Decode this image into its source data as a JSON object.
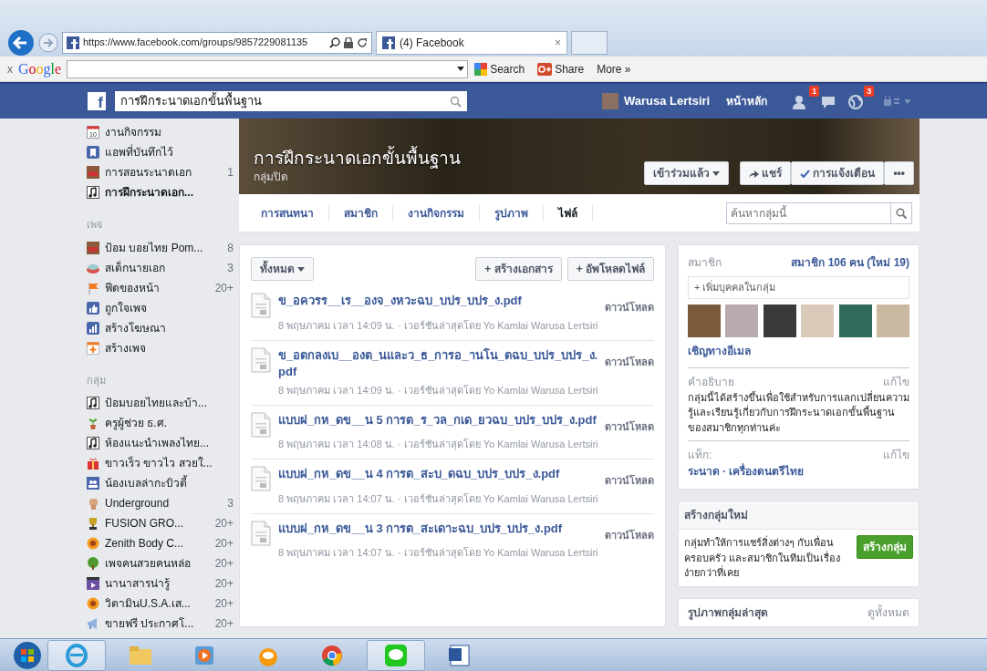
{
  "browser": {
    "address": "https://www.facebook.com/groups/9857229081135",
    "tabs": [
      {
        "title": "(4) Facebook",
        "close": "×",
        "selected": true
      }
    ],
    "toolbar": {
      "close": "x",
      "logo": "Google",
      "search": "Search",
      "share": "Share",
      "more": "More »"
    }
  },
  "fb_header": {
    "logo": "f",
    "search_value": "การฝึกระนาดเอกขั้นพื้นฐาน",
    "user": "Warusa Lertsiri",
    "home": "หน้าหลัก",
    "notifications": [
      {
        "kind": "friends",
        "count": "1"
      },
      {
        "kind": "messages"
      },
      {
        "kind": "globe",
        "count": "3"
      }
    ]
  },
  "sidebar": [
    {
      "items": [
        {
          "kind": "calendar",
          "icon_text": "10",
          "label": "งานกิจกรรม",
          "selected": false
        },
        {
          "kind": "bookmark",
          "label": "แอพที่บันทึกไว้",
          "selected": false
        },
        {
          "kind": "photo",
          "label": "การสอนระนาดเอก",
          "count": "1",
          "selected": false
        },
        {
          "kind": "music",
          "label": "การฝึกระนาดเอก...",
          "selected": true
        }
      ]
    },
    {
      "heading": "เพจ",
      "items": [
        {
          "kind": "photo",
          "label": "ป้อม บอยไทย Pom...",
          "count": "8",
          "selected": false
        },
        {
          "kind": "bowl",
          "label": "สเต็กนายเอก",
          "count": "3",
          "selected": false
        },
        {
          "kind": "flag",
          "label": "ฟีดของหน้า",
          "count": "20+",
          "selected": false
        },
        {
          "kind": "like",
          "label": "ถูกใจเพจ",
          "selected": false
        },
        {
          "kind": "chart",
          "label": "สร้างโฆษณา",
          "selected": false
        },
        {
          "kind": "plus",
          "label": "สร้างเพจ",
          "selected": false
        }
      ]
    },
    {
      "heading": "กลุ่ม",
      "items": [
        {
          "kind": "music",
          "label": "ป้อมบอยไทยและบ้า...",
          "selected": false
        },
        {
          "kind": "plant",
          "label": "ครูผู้ช่วย ธ.ศ.",
          "selected": false
        },
        {
          "kind": "music",
          "label": "ห้องแนะนำเพลงไทย...",
          "selected": false
        },
        {
          "kind": "gift",
          "label": "ขาวเร็ว ขาวไว สวยใ...",
          "selected": false
        },
        {
          "kind": "people",
          "label": "น้องเบลล่ากะบิวตี้",
          "selected": false
        },
        {
          "kind": "fist",
          "label": "Underground",
          "count": "3",
          "selected": false
        },
        {
          "kind": "trophy",
          "label": "FUSION GRO...",
          "count": "20+",
          "selected": false
        },
        {
          "kind": "flower",
          "label": "Zenith Body C...",
          "count": "20+",
          "selected": false
        },
        {
          "kind": "tree",
          "label": "เพจคนสวยคนหล่อ",
          "count": "20+",
          "selected": false
        },
        {
          "kind": "film",
          "label": "นานาสารน่ารู้",
          "count": "20+",
          "selected": false
        },
        {
          "kind": "flower",
          "label": "วิตามินU.S.A.เส...",
          "count": "20+",
          "selected": false
        },
        {
          "kind": "megaphone",
          "label": "ขายฟรี ประกาศโ...",
          "count": "20+",
          "selected": false
        }
      ]
    }
  ],
  "group": {
    "title": "การฝึกระนาดเอกขั้นพื้นฐาน",
    "privacy": "กลุ่มปิด",
    "joined": "เข้าร่วมแล้ว",
    "share": "แชร์",
    "notifications": "การแจ้งเตือน",
    "more": "•••",
    "tabs": [
      {
        "label": "การสนทนา",
        "selected": false
      },
      {
        "label": "สมาชิก",
        "selected": false
      },
      {
        "label": "งานกิจกรรม",
        "selected": false
      },
      {
        "label": "รูปภาพ",
        "selected": false
      },
      {
        "label": "ไฟล์",
        "selected": true
      }
    ],
    "search_placeholder": "ค้นหากลุ่มนี้"
  },
  "files": {
    "filter": "ทั้งหมด",
    "create": "+ สร้างเอกสาร",
    "upload": "+ อัพโหลดไฟล์",
    "items": [
      {
        "name": "ข_อควรร__เร__องจ_งหวะฉบ_บปร_บปร_ง.pdf",
        "meta": "8 พฤษภาคม เวลา 14:09 น. · เวอร์ชันล่าสุดโดย Yo Kamlai Warusa Lertsiri",
        "action": "ดาวน์โหลด"
      },
      {
        "name": "ข_อตกลงเบ__องต_นและว_ธ_การอ_านโน_ตฉบ_บปร_บปร_ง.pdf",
        "meta": "8 พฤษภาคม เวลา 14:09 น. · เวอร์ชันล่าสุดโดย Yo Kamlai Warusa Lertsiri",
        "action": "ดาวน์โหลด"
      },
      {
        "name": "แบบฝ_กห_ดข__น 5 การต_ร_วล_กเด_ยวฉบ_บปร_บปร_ง.pdf",
        "meta": "8 พฤษภาคม เวลา 14:08 น. · เวอร์ชันล่าสุดโดย Yo Kamlai Warusa Lertsiri",
        "action": "ดาวน์โหลด"
      },
      {
        "name": "แบบฝ_กห_ดข__น 4 การต_สะบ_ดฉบ_บปร_บปร_ง.pdf",
        "meta": "8 พฤษภาคม เวลา 14:07 น. · เวอร์ชันล่าสุดโดย Yo Kamlai Warusa Lertsiri",
        "action": "ดาวน์โหลด"
      },
      {
        "name": "แบบฝ_กห_ดข__น 3 การต_สะเดาะฉบ_บปร_บปร_ง.pdf",
        "meta": "8 พฤษภาคม เวลา 14:07 น. · เวอร์ชันล่าสุดโดย Yo Kamlai Warusa Lertsiri",
        "action": "ดาวน์โหลด"
      }
    ]
  },
  "members": {
    "label": "สมาชิก",
    "count": "สมาชิก 106 คน (ใหม่ 19)",
    "add_placeholder": "+ เพิ่มบุคคลในกลุ่ม",
    "invite": "เชิญทางอีเมล",
    "description_label": "คำอธิบาย",
    "description_edit": "แก้ไข",
    "description": "กลุ่มนี้ได้สร้างขึ้นเพื่อใช้สำหรับการแลกเปลี่ยนความรู้และเรียนรู้เกี่ยวกับการฝึกระนาดเอกขั้นพื้นฐานของสมาชิกทุกท่านค่ะ",
    "tags_label": "แท็ก:",
    "tags_edit": "แก้ไข",
    "tags": [
      "ระนาด",
      "เครื่องดนตรีไทย"
    ],
    "tags_separator": "·"
  },
  "create_group": {
    "title": "สร้างกลุ่มใหม่",
    "text": "กลุ่มทำให้การแชร์สิ่งต่างๆ กับเพื่อน ครอบครัว และสมาชิกในทีมเป็นเรื่องง่ายกว่าที่เคย",
    "button": "สร้างกลุ่ม"
  },
  "recent_photos": {
    "title": "รูปภาพกลุ่มล่าสุด",
    "see_all": "ดูทั้งหมด"
  },
  "taskbar": [
    {
      "kind": "ie",
      "selected": true
    },
    {
      "kind": "folder",
      "selected": false
    },
    {
      "kind": "media",
      "selected": false
    },
    {
      "kind": "player",
      "selected": false
    },
    {
      "kind": "chrome",
      "selected": false
    },
    {
      "kind": "line",
      "selected": true
    },
    {
      "kind": "word",
      "selected": false
    }
  ]
}
